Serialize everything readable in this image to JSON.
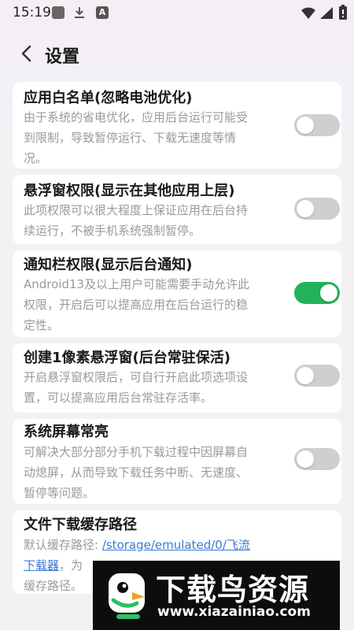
{
  "status_bar": {
    "time": "15:19",
    "icons": [
      "gallery-icon",
      "download-icon",
      "a-app-icon",
      "wifi-icon",
      "signal-icon",
      "battery-icon"
    ],
    "a_label": "A"
  },
  "header": {
    "back_icon": "chevron-left-icon",
    "title": "设置"
  },
  "settings": [
    {
      "title": "应用白名单(忽略电池优化)",
      "desc_lines": [
        "由于系统的省电优化，应用后台运行可能受",
        "到限制，导致暂停运行、下载无速度等情",
        "况。"
      ],
      "enabled": false
    },
    {
      "title": "悬浮窗权限(显示在其他应用上层)",
      "desc_lines": [
        "此项权限可以很大程度上保证应用在后台持",
        "续运行，不被手机系统强制暂停。"
      ],
      "enabled": false
    },
    {
      "title": "通知栏权限(显示后台通知)",
      "desc_lines": [
        "Android13及以上用户可能需要手动允许此",
        "权限，开启后可以提高应用在后台运行的稳",
        "定性。"
      ],
      "enabled": true
    },
    {
      "title": "创建1像素悬浮窗(后台常驻保活)",
      "desc_lines": [
        "开启悬浮窗权限后，可自行开启此项选项设",
        "置，可以提高应用后台常驻存活率。"
      ],
      "enabled": false
    },
    {
      "title": "系统屏幕常亮",
      "desc_lines": [
        "可解决大部分部分手机下载过程中因屏幕自",
        "动熄屏，从而导致下载任务中断、无速度、",
        "暂停等问题。"
      ],
      "enabled": false
    }
  ],
  "cache_path": {
    "title": "文件下载缓存路径",
    "prefix": "默认缓存路径: ",
    "path_part1": "/storage/emulated/0/飞流",
    "path_part2": "下载器",
    "after_path": "，为",
    "last_line": "缓存路径。"
  },
  "watermark": {
    "title": "下载鸟资源",
    "url": "www.xiazainiao.com"
  },
  "colors": {
    "toggle_on": "#22b25c",
    "toggle_off": "#cfcfcf",
    "link": "#3a78d6"
  }
}
